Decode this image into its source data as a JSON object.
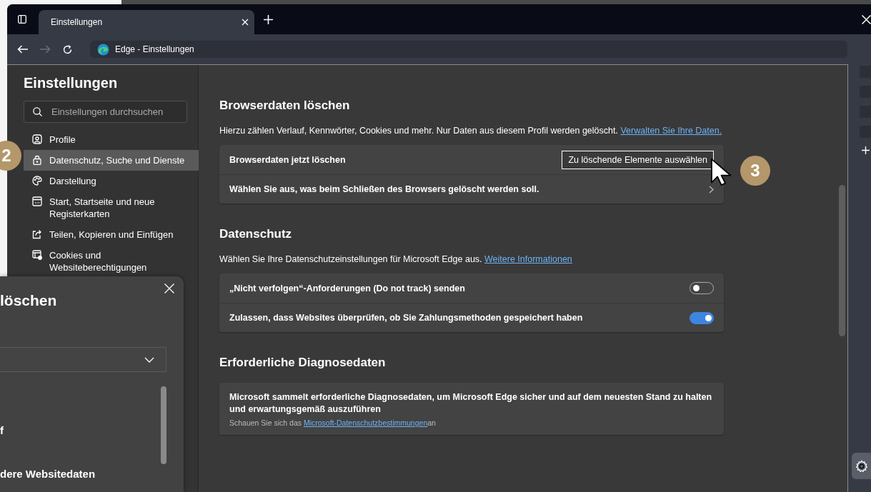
{
  "tab_bar": {
    "tabs": [
      {
        "title": "Einstellungen",
        "selected": true
      }
    ]
  },
  "address_bar": {
    "text": "Edge - Einstellungen"
  },
  "sidebar": {
    "title": "Einstellungen",
    "search": {
      "placeholder": "Einstellungen durchsuchen"
    },
    "items": [
      {
        "label": "Profile",
        "kind": "profile",
        "selected": false
      },
      {
        "label": "Datenschutz, Suche und Dienste",
        "kind": "lock",
        "selected": true
      },
      {
        "label": "Darstellung",
        "kind": "palette",
        "selected": false
      },
      {
        "label": "Start, Startseite und neue Registerkarten",
        "kind": "home",
        "selected": false
      },
      {
        "label": "Teilen, Kopieren und Einfügen",
        "kind": "share",
        "selected": false
      },
      {
        "label": "Cookies und Websiteberechtigungen",
        "kind": "cookies",
        "selected": false
      }
    ]
  },
  "sections": [
    {
      "title": "Browserdaten löschen",
      "description": "Hierzu zählen Verlauf, Kennwörter, Cookies und mehr. Nur Daten aus diesem Profil werden gelöscht. ",
      "link": "Verwalten Sie Ihre Daten.",
      "rows": [
        {
          "kind": "button",
          "label": "Browserdaten jetzt löschen",
          "button": "Zu löschende Elemente auswählen"
        },
        {
          "kind": "chevron",
          "label": "Wählen Sie aus, was beim Schließen des Browsers gelöscht werden soll."
        }
      ]
    },
    {
      "title": "Datenschutz",
      "description": "Wählen Sie Ihre Datenschutzeinstellungen für Microsoft Edge aus. ",
      "link": "Weitere Informationen",
      "rows": [
        {
          "kind": "toggle",
          "label": "„Nicht verfolgen“-Anforderungen (Do not track) senden",
          "on": false
        },
        {
          "kind": "toggle",
          "label": "Zulassen, dass Websites überprüfen, ob Sie Zahlungsmethoden gespeichert haben",
          "on": true
        }
      ]
    },
    {
      "title": "Erforderliche Diagnosedaten",
      "rows": [
        {
          "kind": "text",
          "label": "Microsoft sammelt erforderliche Diagnosedaten, um Microsoft Edge sicher und auf dem neuesten Stand zu halten und erwartungsgemäß auszuführen",
          "note": "Schauen Sie sich das ",
          "note_link": "Microsoft-Datenschutzbestimmungen",
          "note_end": "an"
        }
      ]
    }
  ],
  "dialog": {
    "title": "löschen",
    "lines": [
      "f",
      "dere Websitedaten"
    ]
  },
  "callouts": [
    {
      "number": "2",
      "kind": "sidebar"
    },
    {
      "number": "3",
      "kind": "button"
    }
  ]
}
